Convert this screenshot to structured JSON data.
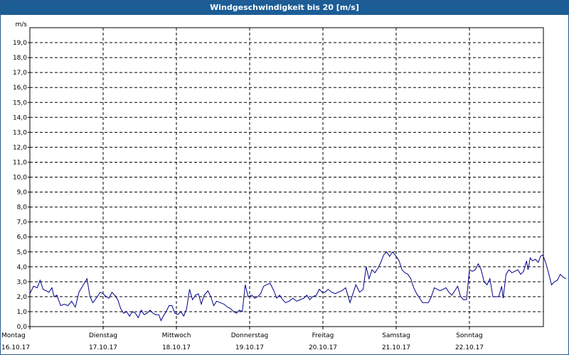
{
  "window": {
    "title": "Windgeschwindigkeit bis 20 [m/s]"
  },
  "chart_data": {
    "type": "line",
    "title": "Windgeschwindigkeit bis 20 [m/s]",
    "ylabel": "m/s",
    "xlabel": "",
    "ylim": [
      0,
      20
    ],
    "yticks": [
      "0,0",
      "1,0",
      "2,0",
      "3,0",
      "4,0",
      "5,0",
      "6,0",
      "7,0",
      "8,0",
      "9,0",
      "10,0",
      "11,0",
      "12,0",
      "13,0",
      "14,0",
      "15,0",
      "16,0",
      "17,0",
      "18,0",
      "19,0"
    ],
    "x_range_days": [
      0,
      7
    ],
    "x_ticks": [
      {
        "day": "Montag",
        "date": "16.10.17"
      },
      {
        "day": "Dienstag",
        "date": "17.10.17"
      },
      {
        "day": "Mittwoch",
        "date": "18.10.17"
      },
      {
        "day": "Donnerstag",
        "date": "19.10.17"
      },
      {
        "day": "Freitag",
        "date": "20.10.17"
      },
      {
        "day": "Samstag",
        "date": "21.10.17"
      },
      {
        "day": "Sonntag",
        "date": "22.10.17"
      }
    ],
    "grid": true,
    "line_color": "#00008b",
    "series": [
      {
        "points": [
          [
            0.0,
            2.2
          ],
          [
            0.05,
            2.7
          ],
          [
            0.1,
            2.6
          ],
          [
            0.14,
            3.1
          ],
          [
            0.18,
            2.5
          ],
          [
            0.22,
            2.4
          ],
          [
            0.26,
            2.3
          ],
          [
            0.3,
            2.6
          ],
          [
            0.33,
            2.0
          ],
          [
            0.37,
            2.1
          ],
          [
            0.42,
            1.4
          ],
          [
            0.47,
            1.5
          ],
          [
            0.52,
            1.4
          ],
          [
            0.57,
            1.7
          ],
          [
            0.62,
            1.3
          ],
          [
            0.67,
            2.3
          ],
          [
            0.73,
            2.8
          ],
          [
            0.78,
            3.2
          ],
          [
            0.82,
            2.0
          ],
          [
            0.86,
            1.6
          ],
          [
            0.92,
            2.0
          ],
          [
            0.96,
            2.3
          ],
          [
            1.0,
            2.2
          ],
          [
            1.04,
            2.0
          ],
          [
            1.08,
            1.9
          ],
          [
            1.12,
            2.3
          ],
          [
            1.16,
            2.1
          ],
          [
            1.2,
            1.8
          ],
          [
            1.24,
            1.2
          ],
          [
            1.28,
            0.9
          ],
          [
            1.32,
            1.0
          ],
          [
            1.36,
            0.7
          ],
          [
            1.4,
            1.0
          ],
          [
            1.44,
            0.9
          ],
          [
            1.48,
            0.6
          ],
          [
            1.52,
            1.1
          ],
          [
            1.56,
            0.8
          ],
          [
            1.6,
            0.9
          ],
          [
            1.64,
            1.1
          ],
          [
            1.68,
            0.9
          ],
          [
            1.72,
            0.8
          ],
          [
            1.76,
            0.8
          ],
          [
            1.79,
            0.4
          ],
          [
            1.82,
            0.7
          ],
          [
            1.86,
            1.0
          ],
          [
            1.9,
            1.4
          ],
          [
            1.94,
            1.4
          ],
          [
            1.98,
            0.9
          ],
          [
            2.02,
            0.8
          ],
          [
            2.06,
            1.0
          ],
          [
            2.1,
            0.7
          ],
          [
            2.14,
            1.2
          ],
          [
            2.18,
            2.5
          ],
          [
            2.22,
            1.8
          ],
          [
            2.26,
            2.1
          ],
          [
            2.3,
            2.2
          ],
          [
            2.34,
            1.5
          ],
          [
            2.38,
            2.1
          ],
          [
            2.43,
            2.4
          ],
          [
            2.47,
            2.0
          ],
          [
            2.51,
            1.4
          ],
          [
            2.55,
            1.7
          ],
          [
            2.6,
            1.6
          ],
          [
            2.65,
            1.5
          ],
          [
            2.7,
            1.3
          ],
          [
            2.74,
            1.2
          ],
          [
            2.78,
            1.0
          ],
          [
            2.82,
            0.9
          ],
          [
            2.86,
            1.1
          ],
          [
            2.9,
            1.0
          ],
          [
            2.94,
            2.8
          ],
          [
            2.98,
            2.0
          ],
          [
            3.03,
            2.1
          ],
          [
            3.07,
            1.9
          ],
          [
            3.11,
            2.0
          ],
          [
            3.15,
            2.2
          ],
          [
            3.19,
            2.7
          ],
          [
            3.23,
            2.8
          ],
          [
            3.28,
            2.9
          ],
          [
            3.33,
            2.4
          ],
          [
            3.37,
            1.9
          ],
          [
            3.41,
            2.1
          ],
          [
            3.45,
            1.8
          ],
          [
            3.49,
            1.6
          ],
          [
            3.54,
            1.7
          ],
          [
            3.59,
            1.9
          ],
          [
            3.64,
            1.7
          ],
          [
            3.69,
            1.8
          ],
          [
            3.74,
            1.9
          ],
          [
            3.78,
            2.1
          ],
          [
            3.82,
            1.8
          ],
          [
            3.86,
            2.0
          ],
          [
            3.91,
            2.1
          ],
          [
            3.95,
            2.5
          ],
          [
            3.99,
            2.3
          ],
          [
            4.03,
            2.3
          ],
          [
            4.07,
            2.5
          ],
          [
            4.12,
            2.3
          ],
          [
            4.17,
            2.2
          ],
          [
            4.21,
            2.3
          ],
          [
            4.26,
            2.4
          ],
          [
            4.31,
            2.6
          ],
          [
            4.34,
            2.1
          ],
          [
            4.37,
            1.6
          ],
          [
            4.41,
            2.2
          ],
          [
            4.45,
            2.8
          ],
          [
            4.5,
            2.3
          ],
          [
            4.55,
            2.5
          ],
          [
            4.59,
            4.0
          ],
          [
            4.63,
            3.2
          ],
          [
            4.67,
            3.8
          ],
          [
            4.71,
            3.6
          ],
          [
            4.75,
            3.9
          ],
          [
            4.79,
            4.3
          ],
          [
            4.83,
            4.8
          ],
          [
            4.87,
            5.0
          ],
          [
            4.91,
            4.7
          ],
          [
            4.95,
            5.0
          ],
          [
            5.0,
            4.7
          ],
          [
            5.04,
            4.4
          ],
          [
            5.08,
            3.8
          ],
          [
            5.12,
            3.6
          ],
          [
            5.16,
            3.5
          ],
          [
            5.2,
            3.2
          ],
          [
            5.24,
            2.6
          ],
          [
            5.28,
            2.2
          ],
          [
            5.32,
            1.9
          ],
          [
            5.36,
            1.6
          ],
          [
            5.4,
            1.6
          ],
          [
            5.44,
            1.6
          ],
          [
            5.48,
            2.0
          ],
          [
            5.52,
            2.6
          ],
          [
            5.56,
            2.5
          ],
          [
            5.6,
            2.4
          ],
          [
            5.64,
            2.5
          ],
          [
            5.68,
            2.6
          ],
          [
            5.72,
            2.3
          ],
          [
            5.76,
            2.1
          ],
          [
            5.8,
            2.4
          ],
          [
            5.84,
            2.7
          ],
          [
            5.88,
            2.0
          ],
          [
            5.92,
            1.8
          ],
          [
            5.96,
            1.8
          ],
          [
            6.0,
            3.8
          ],
          [
            6.04,
            3.7
          ],
          [
            6.08,
            3.8
          ],
          [
            6.12,
            4.2
          ],
          [
            6.16,
            3.8
          ],
          [
            6.2,
            3.0
          ],
          [
            6.24,
            2.8
          ],
          [
            6.28,
            3.2
          ],
          [
            6.32,
            2.0
          ],
          [
            6.36,
            2.0
          ],
          [
            6.4,
            2.0
          ],
          [
            6.44,
            2.7
          ],
          [
            6.46,
            1.9
          ],
          [
            6.5,
            3.5
          ],
          [
            6.54,
            3.8
          ],
          [
            6.58,
            3.6
          ],
          [
            6.62,
            3.7
          ],
          [
            6.66,
            3.8
          ],
          [
            6.7,
            3.5
          ],
          [
            6.74,
            3.7
          ],
          [
            6.78,
            4.4
          ],
          [
            6.8,
            3.8
          ],
          [
            6.83,
            4.6
          ],
          [
            6.86,
            4.4
          ],
          [
            6.9,
            4.5
          ],
          [
            6.94,
            4.3
          ],
          [
            6.97,
            4.7
          ],
          [
            7.0,
            4.8
          ]
        ]
      },
      {
        "points": [
          [
            7.0,
            4.8
          ],
          [
            7.04,
            4.3
          ],
          [
            7.08,
            3.6
          ],
          [
            7.12,
            2.8
          ],
          [
            7.16,
            3.0
          ],
          [
            7.2,
            3.1
          ],
          [
            7.24,
            3.5
          ],
          [
            7.28,
            3.3
          ],
          [
            7.32,
            3.2
          ]
        ],
        "continuation": true
      }
    ]
  }
}
